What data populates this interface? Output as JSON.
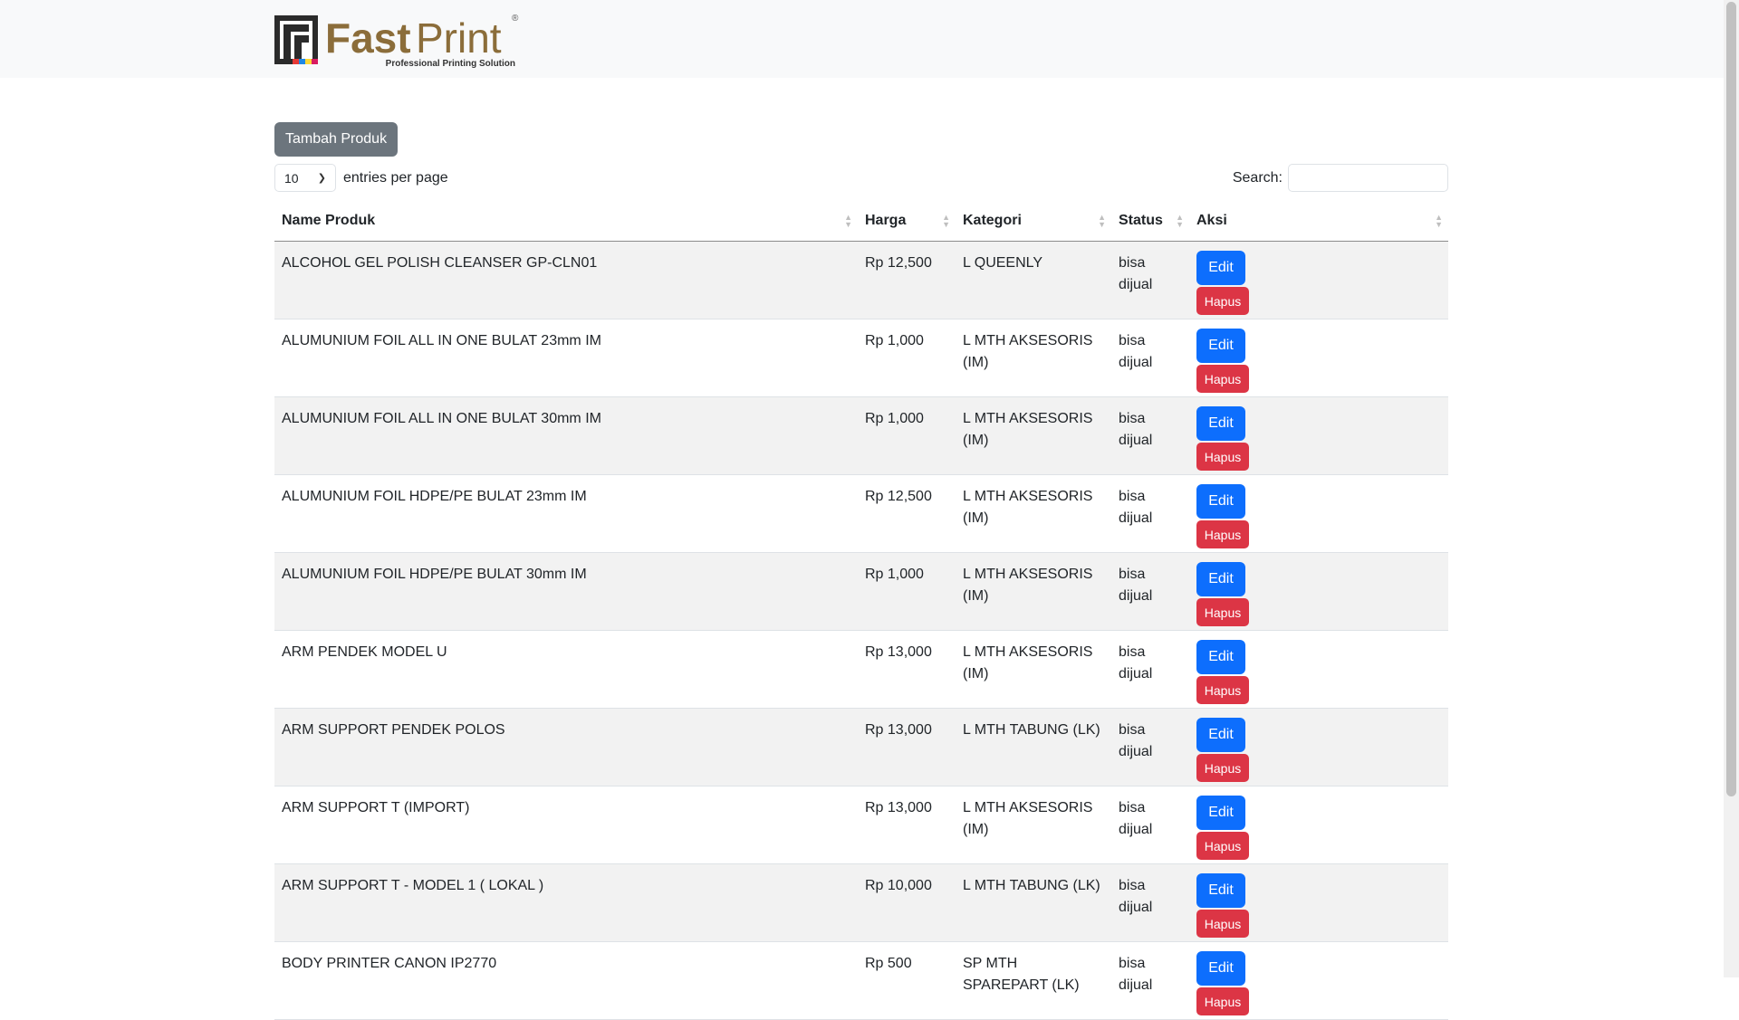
{
  "brand": {
    "name_fast": "Fast",
    "name_print": "Print",
    "tagline": "Professional Printing Solution",
    "registered": "®"
  },
  "colors": {
    "navbar_bg": "#f8f9fa",
    "brand_gold": "#8b6d3a",
    "secondary": "#6c757d",
    "primary": "#0d6efd",
    "danger": "#dc3545"
  },
  "toolbar": {
    "add_button": "Tambah Produk"
  },
  "length_menu": {
    "value": "10",
    "label": "entries per page"
  },
  "search": {
    "label": "Search:",
    "value": ""
  },
  "table": {
    "headers": [
      "Name Produk",
      "Harga",
      "Kategori",
      "Status",
      "Aksi"
    ],
    "edit_label": "Edit",
    "delete_label": "Hapus",
    "rows": [
      {
        "name": "ALCOHOL GEL POLISH CLEANSER GP-CLN01",
        "price": "Rp 12,500",
        "category": "L QUEENLY",
        "status": "bisa dijual"
      },
      {
        "name": "ALUMUNIUM FOIL ALL IN ONE BULAT 23mm IM",
        "price": "Rp 1,000",
        "category": "L MTH AKSESORIS (IM)",
        "status": "bisa dijual"
      },
      {
        "name": "ALUMUNIUM FOIL ALL IN ONE BULAT 30mm IM",
        "price": "Rp 1,000",
        "category": "L MTH AKSESORIS (IM)",
        "status": "bisa dijual"
      },
      {
        "name": "ALUMUNIUM FOIL HDPE/PE BULAT 23mm IM",
        "price": "Rp 12,500",
        "category": "L MTH AKSESORIS (IM)",
        "status": "bisa dijual"
      },
      {
        "name": "ALUMUNIUM FOIL HDPE/PE BULAT 30mm IM",
        "price": "Rp 1,000",
        "category": "L MTH AKSESORIS (IM)",
        "status": "bisa dijual"
      },
      {
        "name": "ARM PENDEK MODEL U",
        "price": "Rp 13,000",
        "category": "L MTH AKSESORIS (IM)",
        "status": "bisa dijual"
      },
      {
        "name": "ARM SUPPORT PENDEK POLOS",
        "price": "Rp 13,000",
        "category": "L MTH TABUNG (LK)",
        "status": "bisa dijual"
      },
      {
        "name": "ARM SUPPORT T (IMPORT)",
        "price": "Rp 13,000",
        "category": "L MTH AKSESORIS (IM)",
        "status": "bisa dijual"
      },
      {
        "name": "ARM SUPPORT T - MODEL 1 ( LOKAL )",
        "price": "Rp 10,000",
        "category": "L MTH TABUNG (LK)",
        "status": "bisa dijual"
      },
      {
        "name": "BODY PRINTER CANON IP2770",
        "price": "Rp 500",
        "category": "SP MTH SPAREPART (LK)",
        "status": "bisa dijual"
      }
    ]
  }
}
